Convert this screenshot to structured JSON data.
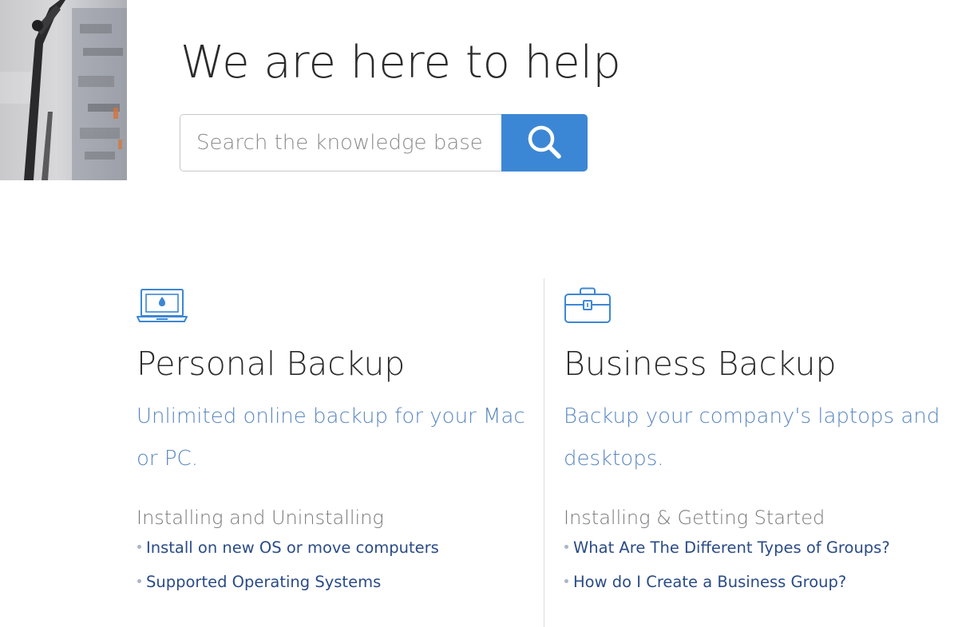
{
  "hero": {
    "title": "We are here to help",
    "search": {
      "placeholder": "Search the knowledge base",
      "button_icon": "search-icon"
    }
  },
  "columns": [
    {
      "icon": "laptop-icon",
      "title": "Personal Backup",
      "tagline": "Unlimited online backup for your Mac or PC.",
      "section": "Installing and Uninstalling",
      "links": [
        "Install on new OS or move computers",
        "Supported Operating Systems"
      ]
    },
    {
      "icon": "briefcase-icon",
      "title": "Business Backup",
      "tagline": "Backup your company's laptops and desktops.",
      "section": "Installing & Getting Started",
      "links": [
        "What Are The Different Types of Groups?",
        "How do I Create a Business Group?"
      ]
    }
  ],
  "colors": {
    "accent": "#3c87d5",
    "tagline": "#5b87c0",
    "link": "#2a4b86",
    "bullet": "#a9b6c8",
    "title": "#2b2b2b",
    "section": "#7a7a7a"
  }
}
